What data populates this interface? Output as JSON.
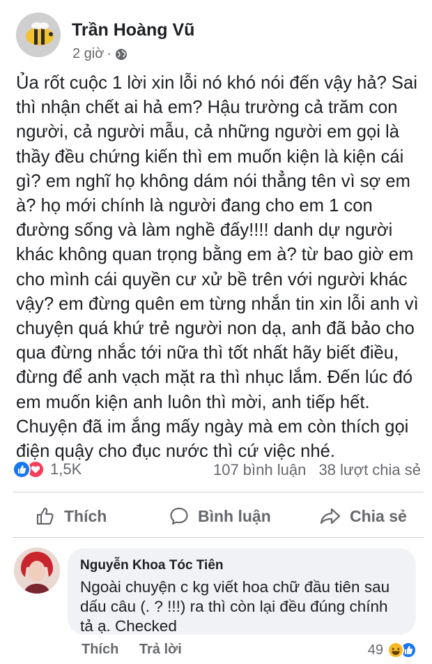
{
  "post": {
    "author": "Trần Hoàng Vũ",
    "time": "2 giờ",
    "separator": "·",
    "audience_icon": "globe-icon",
    "text": "Ủa rốt cuộc 1 lời xin lỗi nó khó nói đến vậy hả? Sai thì nhận chết ai hả em? Hậu trường cả trăm con người, cả người mẫu, cả những người em gọi là thầy đều chứng kiến thì em muốn kiện là kiện cái gì? em nghĩ họ không dám nói thẳng tên vì sợ em à? họ mới chính là người đang cho em 1 con đường sống và làm nghề đấy!!!! danh dự người khác không quan trọng bằng em à? từ bao giờ em cho mình cái quyền cư xử bề trên với người khác vậy? em đừng quên em từng nhắn tin xin lỗi anh vì chuyện quá khứ trẻ người non dạ, anh đã bảo cho qua đừng nhắc tới nữa thì tốt nhất hãy biết điều, đừng để anh vạch mặt ra thì nhục lắm. Đến lúc đó em muốn kiện anh luôn thì mời, anh tiếp hết. Chuyện đã im ắng mấy ngày mà em còn thích gọi điện quậy cho đục nước thì cứ việc nhé."
  },
  "stats": {
    "reactions_count": "1,5K",
    "reaction_icons": [
      "like-icon",
      "love-icon"
    ],
    "comments": "107 bình luận",
    "shares": "38 lượt chia sẻ"
  },
  "actions": {
    "like": "Thích",
    "comment": "Bình luận",
    "share": "Chia sẻ"
  },
  "comment": {
    "author": "Nguyễn Khoa Tóc Tiên",
    "text": "Ngoài chuyện c kg viết hoa chữ đầu tiên sau dấu câu (. ? !!!) ra thì còn lại đều đúng chính tả ạ. Checked",
    "like_label": "Thích",
    "reply_label": "Trả lời",
    "reaction_count": "49",
    "reaction_icons": [
      "haha-icon",
      "like-icon"
    ]
  },
  "colors": {
    "text": "#1c1e21",
    "secondary": "#65676b",
    "like_blue": "#1877f2",
    "love_red": "#f33e58",
    "haha_yellow": "#f7b928",
    "bubble_bg": "#f0f2f5",
    "divider": "#ced0d4"
  }
}
